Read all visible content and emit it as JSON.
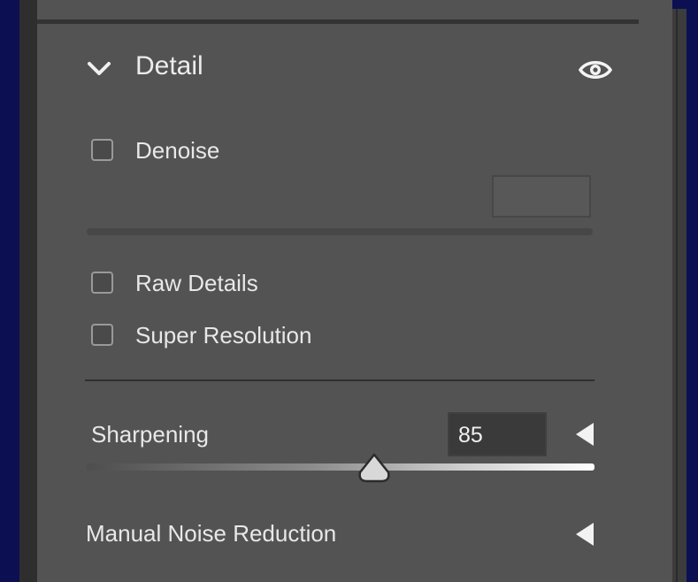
{
  "panel": {
    "title": "Detail",
    "icons": {
      "collapse": "chevron-down-icon",
      "visibility": "eye-icon"
    }
  },
  "denoise": {
    "label": "Denoise",
    "checked": false,
    "amount_value": ""
  },
  "raw_details": {
    "label": "Raw Details",
    "checked": false
  },
  "super_resolution": {
    "label": "Super Resolution",
    "checked": false
  },
  "sharpening": {
    "label": "Sharpening",
    "value": "85",
    "max": 150,
    "expand_icon": "triangle-left-icon"
  },
  "manual_noise_reduction": {
    "label": "Manual Noise Reduction",
    "expand_icon": "triangle-left-icon"
  },
  "colors": {
    "background": "#0c1052",
    "panel": "#535353",
    "text": "#e8e8e8",
    "input": "#3a3a3a"
  }
}
